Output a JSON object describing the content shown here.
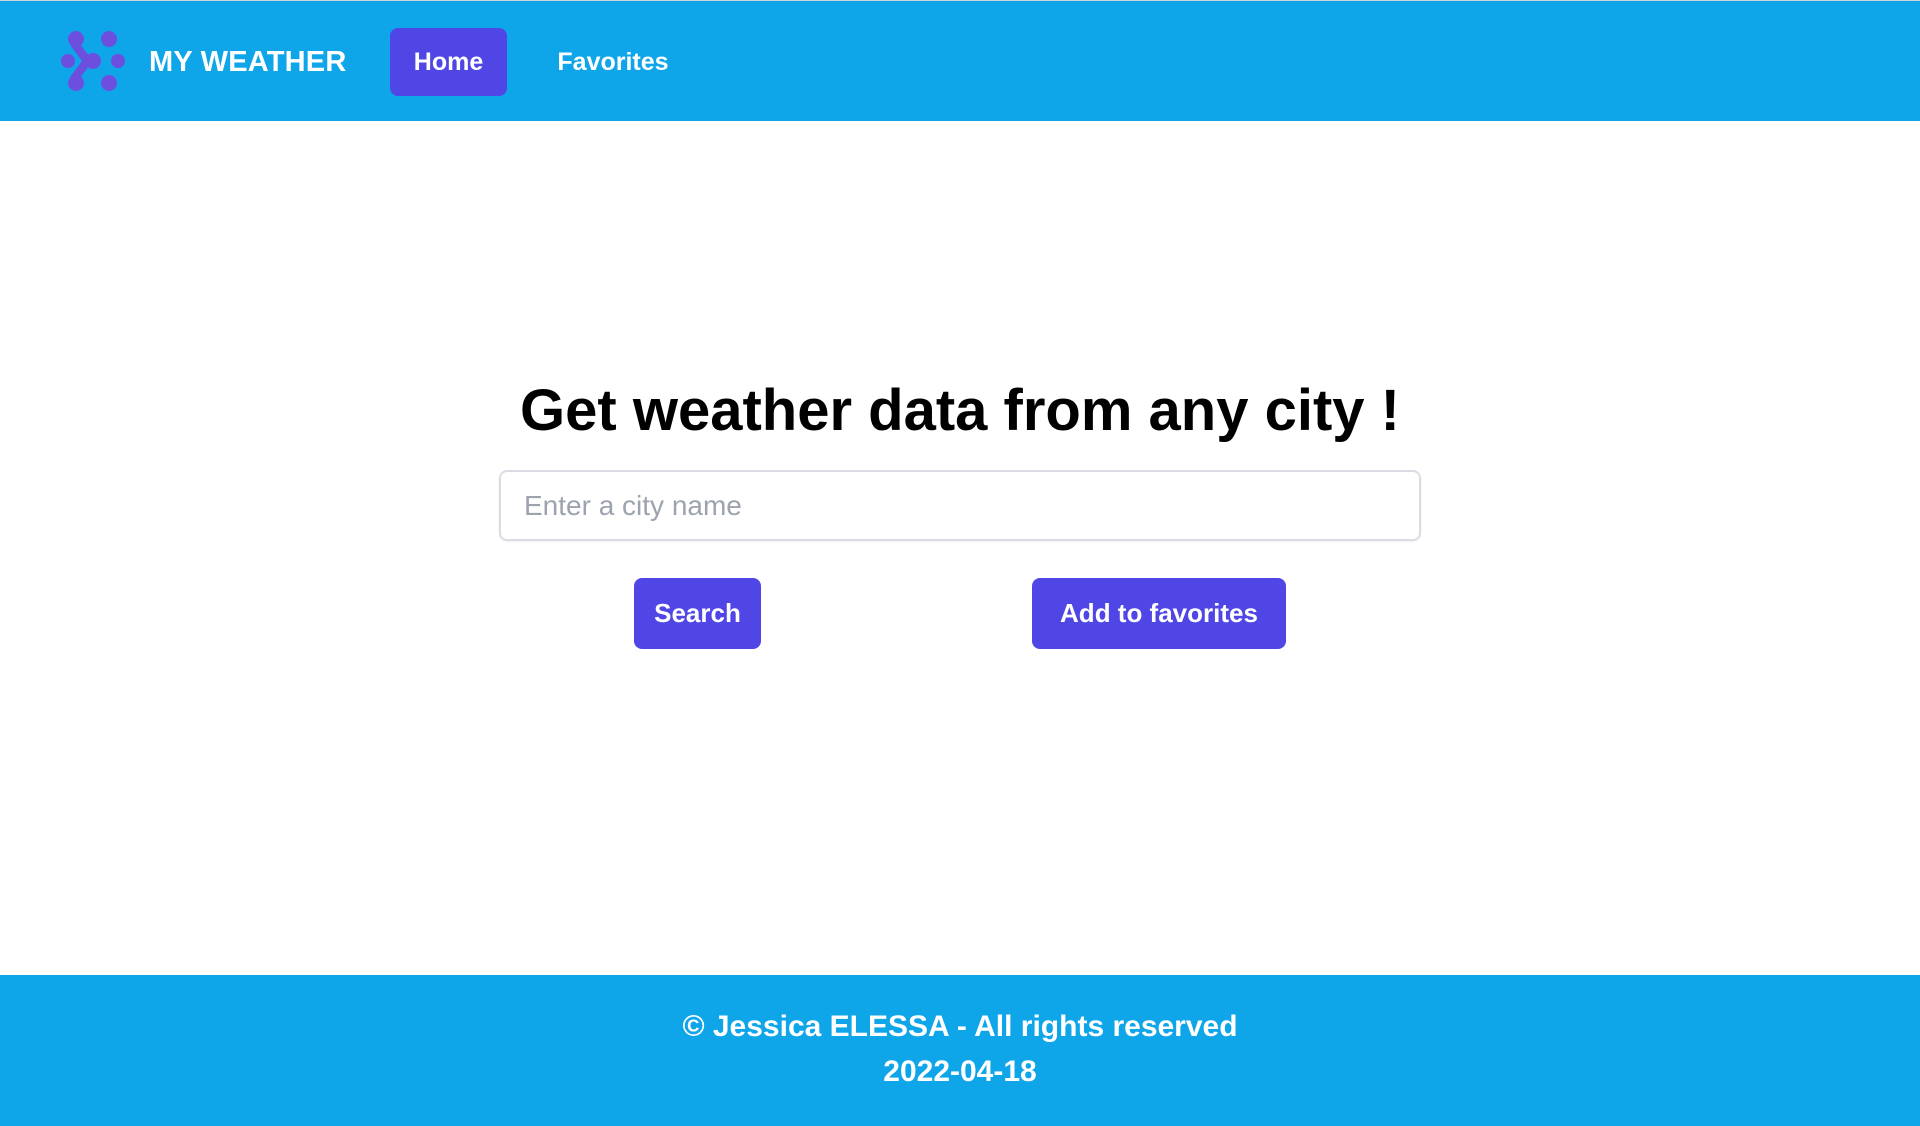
{
  "header": {
    "logo_icon": "dots-chevron-logo-icon",
    "brand": "MY WEATHER",
    "nav": {
      "home": "Home",
      "favorites": "Favorites"
    }
  },
  "main": {
    "title": "Get weather data from any city !",
    "search": {
      "placeholder": "Enter a city name",
      "value": ""
    },
    "buttons": {
      "search": "Search",
      "add_favorites": "Add to favorites"
    }
  },
  "footer": {
    "copyright": "© Jessica ELESSA - All rights reserved",
    "date": "2022-04-18"
  },
  "colors": {
    "header_bg": "#0ea5e9",
    "accent": "#4f46e5",
    "logo": "#6d4fe0",
    "footer_bg": "#0ea5e9"
  }
}
